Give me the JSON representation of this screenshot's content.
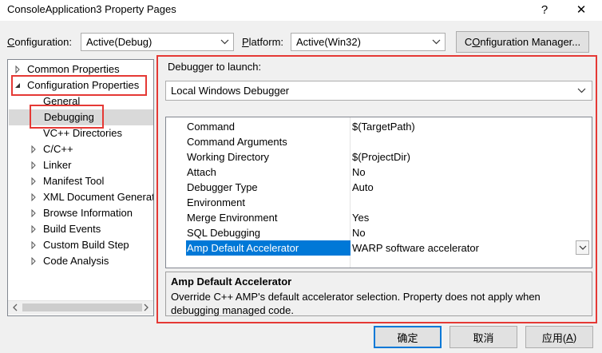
{
  "window": {
    "title": "ConsoleApplication3 Property Pages",
    "help_glyph": "?",
    "close_glyph": "✕"
  },
  "config_row": {
    "configuration_label_u": "C",
    "configuration_label_rest": "onfiguration:",
    "configuration_value": "Active(Debug)",
    "platform_label_u": "P",
    "platform_label_rest": "latform:",
    "platform_value": "Active(Win32)",
    "config_manager_u": "O",
    "config_manager_pre": "C",
    "config_manager_rest": "nfiguration Manager..."
  },
  "tree": {
    "items": [
      {
        "label": "Common Properties",
        "indent": 0,
        "expander": "collapsed"
      },
      {
        "label": "Configuration Properties",
        "indent": 0,
        "expander": "expanded"
      },
      {
        "label": "General",
        "indent": 1,
        "expander": "none"
      },
      {
        "label": "Debugging",
        "indent": 1,
        "expander": "none",
        "selected": true
      },
      {
        "label": "VC++ Directories",
        "indent": 1,
        "expander": "none"
      },
      {
        "label": "C/C++",
        "indent": 1,
        "expander": "collapsed"
      },
      {
        "label": "Linker",
        "indent": 1,
        "expander": "collapsed"
      },
      {
        "label": "Manifest Tool",
        "indent": 1,
        "expander": "collapsed"
      },
      {
        "label": "XML Document Generat",
        "indent": 1,
        "expander": "collapsed"
      },
      {
        "label": "Browse Information",
        "indent": 1,
        "expander": "collapsed"
      },
      {
        "label": "Build Events",
        "indent": 1,
        "expander": "collapsed"
      },
      {
        "label": "Custom Build Step",
        "indent": 1,
        "expander": "collapsed"
      },
      {
        "label": "Code Analysis",
        "indent": 1,
        "expander": "collapsed"
      }
    ]
  },
  "debugger": {
    "label": "Debugger to launch:",
    "value": "Local Windows Debugger"
  },
  "properties": [
    {
      "name": "Command",
      "value": "$(TargetPath)"
    },
    {
      "name": "Command Arguments",
      "value": ""
    },
    {
      "name": "Working Directory",
      "value": "$(ProjectDir)"
    },
    {
      "name": "Attach",
      "value": "No"
    },
    {
      "name": "Debugger Type",
      "value": "Auto"
    },
    {
      "name": "Environment",
      "value": ""
    },
    {
      "name": "Merge Environment",
      "value": "Yes"
    },
    {
      "name": "SQL Debugging",
      "value": "No"
    },
    {
      "name": "Amp Default Accelerator",
      "value": "WARP software accelerator",
      "selected": true
    }
  ],
  "description": {
    "title": "Amp Default Accelerator",
    "text": "Override C++ AMP's default accelerator selection. Property does not apply when debugging managed code."
  },
  "buttons": {
    "ok": "确定",
    "cancel": "取消",
    "apply_pre": "应用(",
    "apply_u": "A",
    "apply_post": ")"
  },
  "colors": {
    "highlight": "#0078d7",
    "annotation_red": "#e53935",
    "tree_selected": "#d9d9d9"
  }
}
